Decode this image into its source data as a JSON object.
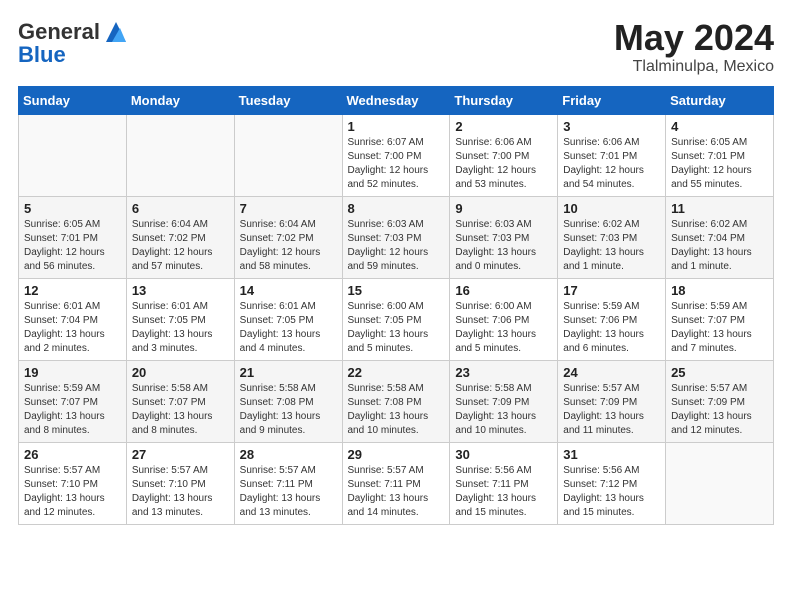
{
  "header": {
    "logo_general": "General",
    "logo_blue": "Blue",
    "month_year": "May 2024",
    "location": "Tlalminulpa, Mexico"
  },
  "days_of_week": [
    "Sunday",
    "Monday",
    "Tuesday",
    "Wednesday",
    "Thursday",
    "Friday",
    "Saturday"
  ],
  "weeks": [
    [
      {
        "day": "",
        "info": ""
      },
      {
        "day": "",
        "info": ""
      },
      {
        "day": "",
        "info": ""
      },
      {
        "day": "1",
        "info": "Sunrise: 6:07 AM\nSunset: 7:00 PM\nDaylight: 12 hours\nand 52 minutes."
      },
      {
        "day": "2",
        "info": "Sunrise: 6:06 AM\nSunset: 7:00 PM\nDaylight: 12 hours\nand 53 minutes."
      },
      {
        "day": "3",
        "info": "Sunrise: 6:06 AM\nSunset: 7:01 PM\nDaylight: 12 hours\nand 54 minutes."
      },
      {
        "day": "4",
        "info": "Sunrise: 6:05 AM\nSunset: 7:01 PM\nDaylight: 12 hours\nand 55 minutes."
      }
    ],
    [
      {
        "day": "5",
        "info": "Sunrise: 6:05 AM\nSunset: 7:01 PM\nDaylight: 12 hours\nand 56 minutes."
      },
      {
        "day": "6",
        "info": "Sunrise: 6:04 AM\nSunset: 7:02 PM\nDaylight: 12 hours\nand 57 minutes."
      },
      {
        "day": "7",
        "info": "Sunrise: 6:04 AM\nSunset: 7:02 PM\nDaylight: 12 hours\nand 58 minutes."
      },
      {
        "day": "8",
        "info": "Sunrise: 6:03 AM\nSunset: 7:03 PM\nDaylight: 12 hours\nand 59 minutes."
      },
      {
        "day": "9",
        "info": "Sunrise: 6:03 AM\nSunset: 7:03 PM\nDaylight: 13 hours\nand 0 minutes."
      },
      {
        "day": "10",
        "info": "Sunrise: 6:02 AM\nSunset: 7:03 PM\nDaylight: 13 hours\nand 1 minute."
      },
      {
        "day": "11",
        "info": "Sunrise: 6:02 AM\nSunset: 7:04 PM\nDaylight: 13 hours\nand 1 minute."
      }
    ],
    [
      {
        "day": "12",
        "info": "Sunrise: 6:01 AM\nSunset: 7:04 PM\nDaylight: 13 hours\nand 2 minutes."
      },
      {
        "day": "13",
        "info": "Sunrise: 6:01 AM\nSunset: 7:05 PM\nDaylight: 13 hours\nand 3 minutes."
      },
      {
        "day": "14",
        "info": "Sunrise: 6:01 AM\nSunset: 7:05 PM\nDaylight: 13 hours\nand 4 minutes."
      },
      {
        "day": "15",
        "info": "Sunrise: 6:00 AM\nSunset: 7:05 PM\nDaylight: 13 hours\nand 5 minutes."
      },
      {
        "day": "16",
        "info": "Sunrise: 6:00 AM\nSunset: 7:06 PM\nDaylight: 13 hours\nand 5 minutes."
      },
      {
        "day": "17",
        "info": "Sunrise: 5:59 AM\nSunset: 7:06 PM\nDaylight: 13 hours\nand 6 minutes."
      },
      {
        "day": "18",
        "info": "Sunrise: 5:59 AM\nSunset: 7:07 PM\nDaylight: 13 hours\nand 7 minutes."
      }
    ],
    [
      {
        "day": "19",
        "info": "Sunrise: 5:59 AM\nSunset: 7:07 PM\nDaylight: 13 hours\nand 8 minutes."
      },
      {
        "day": "20",
        "info": "Sunrise: 5:58 AM\nSunset: 7:07 PM\nDaylight: 13 hours\nand 8 minutes."
      },
      {
        "day": "21",
        "info": "Sunrise: 5:58 AM\nSunset: 7:08 PM\nDaylight: 13 hours\nand 9 minutes."
      },
      {
        "day": "22",
        "info": "Sunrise: 5:58 AM\nSunset: 7:08 PM\nDaylight: 13 hours\nand 10 minutes."
      },
      {
        "day": "23",
        "info": "Sunrise: 5:58 AM\nSunset: 7:09 PM\nDaylight: 13 hours\nand 10 minutes."
      },
      {
        "day": "24",
        "info": "Sunrise: 5:57 AM\nSunset: 7:09 PM\nDaylight: 13 hours\nand 11 minutes."
      },
      {
        "day": "25",
        "info": "Sunrise: 5:57 AM\nSunset: 7:09 PM\nDaylight: 13 hours\nand 12 minutes."
      }
    ],
    [
      {
        "day": "26",
        "info": "Sunrise: 5:57 AM\nSunset: 7:10 PM\nDaylight: 13 hours\nand 12 minutes."
      },
      {
        "day": "27",
        "info": "Sunrise: 5:57 AM\nSunset: 7:10 PM\nDaylight: 13 hours\nand 13 minutes."
      },
      {
        "day": "28",
        "info": "Sunrise: 5:57 AM\nSunset: 7:11 PM\nDaylight: 13 hours\nand 13 minutes."
      },
      {
        "day": "29",
        "info": "Sunrise: 5:57 AM\nSunset: 7:11 PM\nDaylight: 13 hours\nand 14 minutes."
      },
      {
        "day": "30",
        "info": "Sunrise: 5:56 AM\nSunset: 7:11 PM\nDaylight: 13 hours\nand 15 minutes."
      },
      {
        "day": "31",
        "info": "Sunrise: 5:56 AM\nSunset: 7:12 PM\nDaylight: 13 hours\nand 15 minutes."
      },
      {
        "day": "",
        "info": ""
      }
    ]
  ]
}
